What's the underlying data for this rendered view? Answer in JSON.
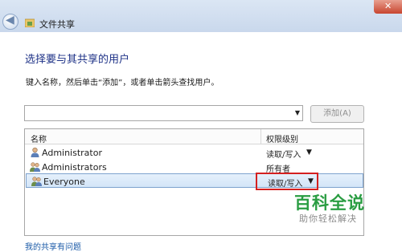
{
  "window": {
    "title": "文件共享",
    "close_glyph": "✕",
    "back_glyph": "◀"
  },
  "heading": "选择要与其共享的用户",
  "instruction": "键入名称，然后单击“添加”，或者单击箭头查找用户。",
  "combo": {
    "value": "",
    "arrow": "▼"
  },
  "add_button": "添加(A)",
  "table": {
    "headers": {
      "name": "名称",
      "permission": "权限级别"
    },
    "rows": [
      {
        "name": "Administrator",
        "permission": "读取/写入",
        "has_dropdown": true
      },
      {
        "name": "Administrators",
        "permission": "所有者",
        "has_dropdown": false
      },
      {
        "name": "Everyone",
        "permission": "读取/写入",
        "has_dropdown": true,
        "selected": true
      }
    ],
    "dropdown_glyph": "▼"
  },
  "watermark": {
    "title": "百科全说",
    "subtitle": "助你轻松解决"
  },
  "help_link": "我的共享有问题",
  "colors": {
    "heading": "#1e3287",
    "link": "#1a5aa7",
    "highlight": "#d42020",
    "watermark": "#2a9d42"
  },
  "icons": [
    "back-arrow-icon",
    "shared-folder-icon",
    "close-icon",
    "dropdown-arrow-icon",
    "user-icon",
    "user-group-icon"
  ]
}
